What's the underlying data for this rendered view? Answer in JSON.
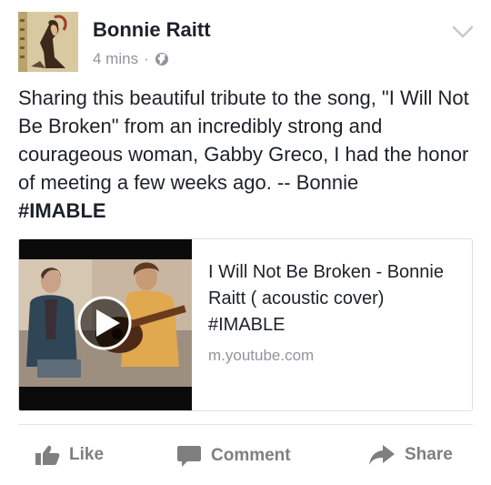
{
  "post": {
    "author": "Bonnie Raitt",
    "time": "4 mins",
    "separator": "·",
    "privacy_icon": "globe-icon",
    "text": "Sharing this beautiful tribute to the song, \"I Will Not Be Broken\" from an incredibly strong and courageous woman, Gabby Greco, I had the honor of meeting a few weeks ago. -- Bonnie",
    "hashtag": "#IMABLE"
  },
  "link_card": {
    "title": "I Will Not Be Broken - Bonnie Raitt ( acoustic cover) #IMABLE",
    "domain": "m.youtube.com",
    "play_icon": "play-icon"
  },
  "actions": {
    "like_label": "Like",
    "comment_label": "Comment",
    "share_label": "Share"
  },
  "colors": {
    "text": "#1d2129",
    "secondary": "#90949c",
    "action": "#7f7f7f",
    "border": "#dddfe2"
  }
}
